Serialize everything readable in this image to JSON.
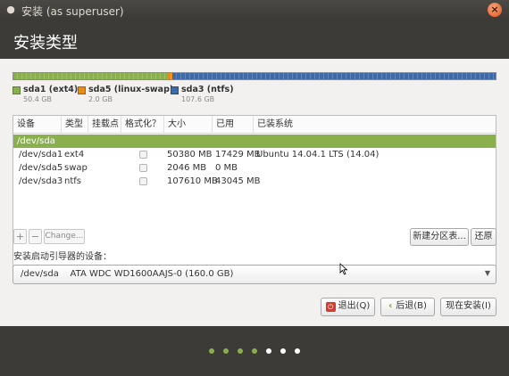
{
  "window": {
    "title": "安装 (as superuser)",
    "menu_glyph": "●"
  },
  "header": {
    "title": "安装类型"
  },
  "disk_bar": {
    "segments": [
      {
        "name": "sda1",
        "color": "#8ab04e",
        "fraction": 0.318
      },
      {
        "name": "sda5",
        "color": "#e58c1c",
        "fraction": 0.012
      },
      {
        "name": "sda3",
        "color": "#3e6aa6",
        "fraction": 0.67
      }
    ]
  },
  "legend": [
    {
      "label": "sda1 (ext4)",
      "size": "50.4 GB",
      "color": "#8ab04e"
    },
    {
      "label": "sda5 (linux-swap)",
      "size": "2.0 GB",
      "color": "#e58c1c"
    },
    {
      "label": "sda3 (ntfs)",
      "size": "107.6 GB",
      "color": "#3e6aa6"
    }
  ],
  "table": {
    "columns": [
      "设备",
      "类型",
      "挂载点",
      "格式化？",
      "大小",
      "已用",
      "已装系统"
    ],
    "device_row": "/dev/sda",
    "rows": [
      {
        "device": "/dev/sda1",
        "type": "ext4",
        "mount": "",
        "format": false,
        "size": "50380 MB",
        "used": "17429 MB",
        "system": "Ubuntu 14.04.1 LTS (14.04)"
      },
      {
        "device": "/dev/sda5",
        "type": "swap",
        "mount": "",
        "format": false,
        "size": "2046 MB",
        "used": "0 MB",
        "system": ""
      },
      {
        "device": "/dev/sda3",
        "type": "ntfs",
        "mount": "",
        "format": false,
        "size": "107610 MB",
        "used": "43045 MB",
        "system": ""
      }
    ]
  },
  "partition_buttons": {
    "add": "+",
    "remove": "−",
    "change": "Change..."
  },
  "new_table_button": "新建分区表...",
  "revert_button": "还原",
  "boot_loader": {
    "label": "安装启动引导器的设备：",
    "selected": "/dev/sda    ATA WDC WD1600AAJS-0 (160.0 GB)"
  },
  "actions": {
    "quit": "退出(Q)",
    "back": "后退(B)",
    "install": "现在安装(I)"
  },
  "progress_dots": {
    "total": 7,
    "completed": 4,
    "done_color": "#8ab04e",
    "todo_color": "#ffffff"
  },
  "icons": {
    "quit_icon": "power-icon",
    "back_icon": "chevron-left-icon",
    "combo_icon": "chevron-down-icon",
    "close_icon": "close-icon"
  }
}
